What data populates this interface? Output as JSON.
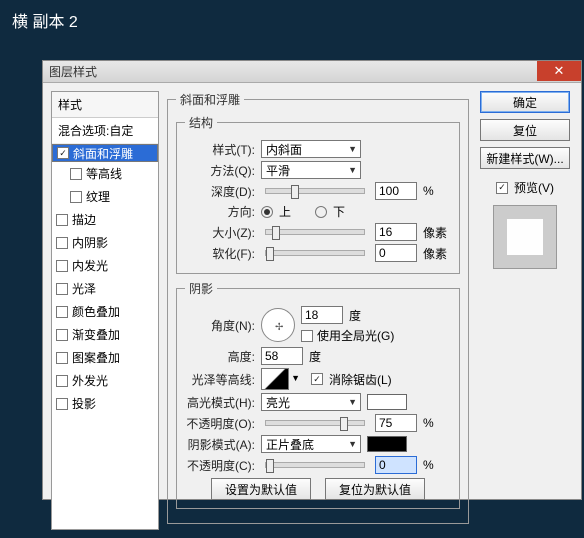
{
  "app_title": "横 副本 2",
  "dialog_title": "图层样式",
  "close_glyph": "✕",
  "styles": {
    "head": "样式",
    "blend": "混合选项:自定",
    "items": [
      {
        "label": "斜面和浮雕",
        "checked": true,
        "selected": true
      },
      {
        "label": "等高线",
        "checked": false,
        "sub": true
      },
      {
        "label": "纹理",
        "checked": false,
        "sub": true
      },
      {
        "label": "描边",
        "checked": false
      },
      {
        "label": "内阴影",
        "checked": false
      },
      {
        "label": "内发光",
        "checked": false
      },
      {
        "label": "光泽",
        "checked": false
      },
      {
        "label": "颜色叠加",
        "checked": false
      },
      {
        "label": "渐变叠加",
        "checked": false
      },
      {
        "label": "图案叠加",
        "checked": false
      },
      {
        "label": "外发光",
        "checked": false
      },
      {
        "label": "投影",
        "checked": false
      }
    ]
  },
  "bevel": {
    "group_label": "斜面和浮雕",
    "struct_label": "结构",
    "style_label": "样式(T):",
    "style_value": "内斜面",
    "tech_label": "方法(Q):",
    "tech_value": "平滑",
    "depth_label": "深度(D):",
    "depth_value": "100",
    "depth_unit": "%",
    "dir_label": "方向:",
    "dir_up": "上",
    "dir_down": "下",
    "size_label": "大小(Z):",
    "size_value": "16",
    "size_unit": "像素",
    "soften_label": "软化(F):",
    "soften_value": "0",
    "soften_unit": "像素"
  },
  "shade": {
    "group_label": "阴影",
    "angle_label": "角度(N):",
    "angle_value": "18",
    "angle_unit": "度",
    "global_label": "使用全局光(G)",
    "alt_label": "高度:",
    "alt_value": "58",
    "alt_unit": "度",
    "contour_label": "光泽等高线:",
    "aa_label": "消除锯齿(L)",
    "hl_mode_label": "高光模式(H):",
    "hl_mode_value": "亮光",
    "hl_color": "#ffffff",
    "hl_op_label": "不透明度(O):",
    "hl_op_value": "75",
    "hl_op_unit": "%",
    "sh_mode_label": "阴影模式(A):",
    "sh_mode_value": "正片叠底",
    "sh_color": "#000000",
    "sh_op_label": "不透明度(C):",
    "sh_op_value": "0",
    "sh_op_unit": "%"
  },
  "footer": {
    "make_default": "设置为默认值",
    "reset_default": "复位为默认值"
  },
  "right": {
    "ok": "确定",
    "cancel": "复位",
    "new_style": "新建样式(W)...",
    "preview_label": "预览(V)"
  }
}
